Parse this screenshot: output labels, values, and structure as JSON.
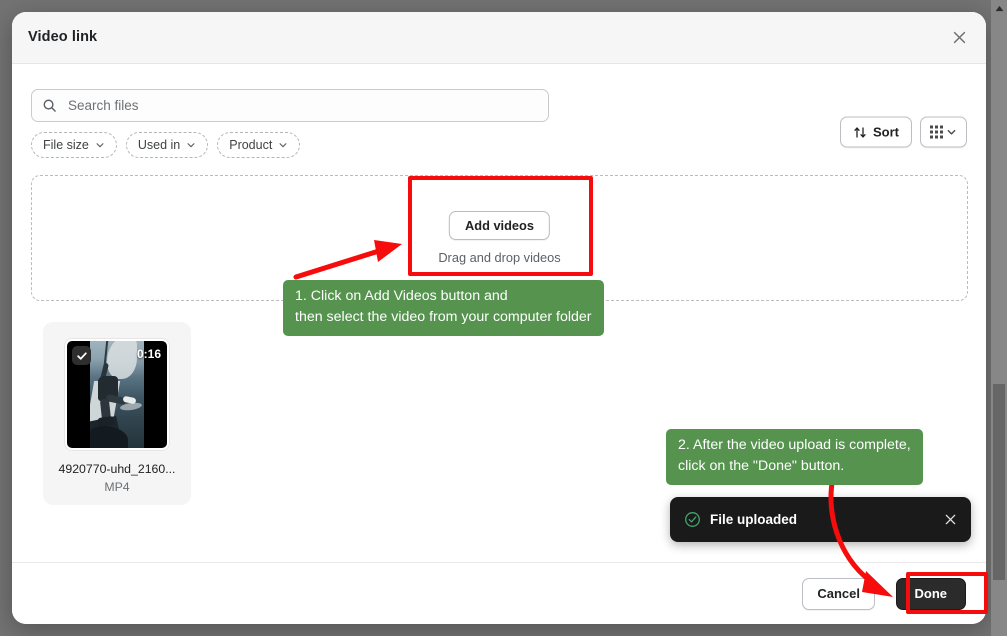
{
  "window": {
    "title": "Video link",
    "close_icon": "close-icon"
  },
  "toolbar": {
    "search_placeholder": "Search files",
    "search_value": "",
    "search_icon": "search-icon",
    "sort_label": "Sort",
    "sort_icon": "sort-arrows-icon",
    "view_icon": "grid-view-icon",
    "view_chevron_icon": "chevron-down-icon"
  },
  "filters": [
    {
      "label": "File size",
      "icon": "chevron-down-icon"
    },
    {
      "label": "Used in",
      "icon": "chevron-down-icon"
    },
    {
      "label": "Product",
      "icon": "chevron-down-icon"
    }
  ],
  "dropzone": {
    "button_label": "Add videos",
    "hint": "Drag and drop videos"
  },
  "files": [
    {
      "name": "4920770-uhd_2160...",
      "type": "MP4",
      "duration": "0:16",
      "selected": true,
      "check_icon": "check-icon"
    }
  ],
  "toast": {
    "message": "File uploaded",
    "status_icon": "check-circle-icon",
    "close_icon": "close-icon"
  },
  "footer": {
    "cancel_label": "Cancel",
    "done_label": "Done"
  },
  "annotations": {
    "callout_1": "1. Click on Add Videos button and\nthen select the video from your computer folder",
    "callout_2": "2. After the video upload is complete,\nclick on the \"Done\" button.",
    "highlight_color": "#f60c0c",
    "callout_color": "#55934e"
  },
  "scrollbar": {
    "up_arrow_icon": "triangle-up-icon"
  }
}
